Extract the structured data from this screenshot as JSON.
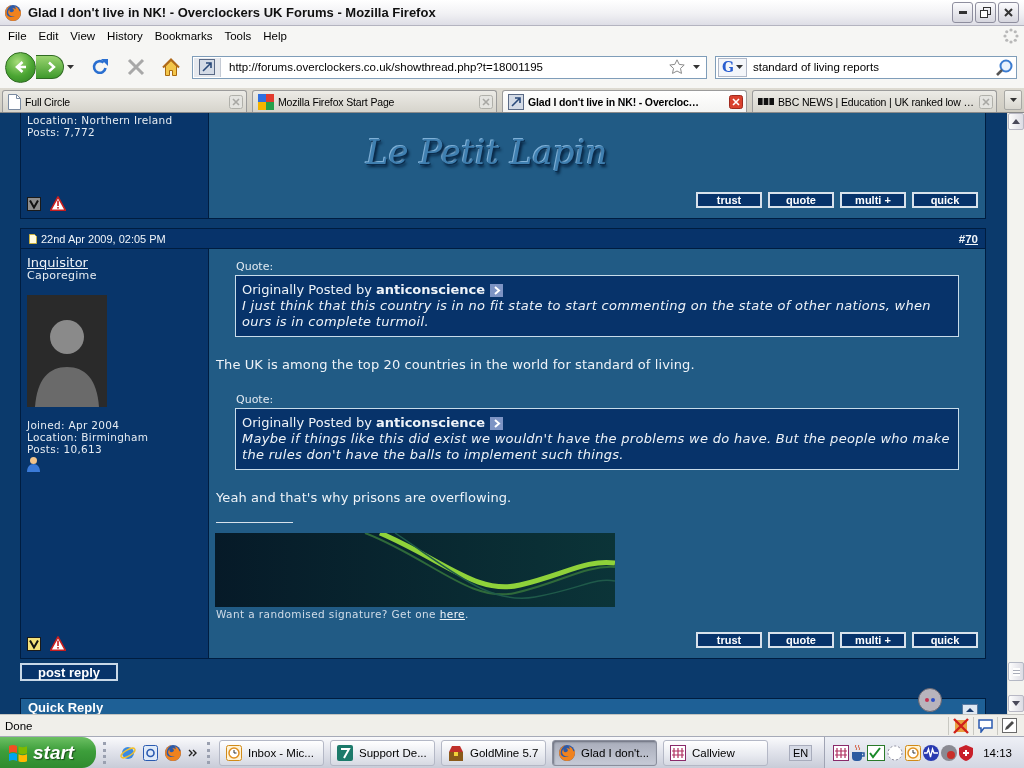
{
  "window": {
    "title": "Glad I don't live in NK! - Overclockers UK Forums - Mozilla Firefox"
  },
  "menu": [
    {
      "label": "File"
    },
    {
      "label": "Edit"
    },
    {
      "label": "View"
    },
    {
      "label": "History"
    },
    {
      "label": "Bookmarks"
    },
    {
      "label": "Tools"
    },
    {
      "label": "Help"
    }
  ],
  "navigation": {
    "address": "http://forums.overclockers.co.uk/showthread.php?t=18001195",
    "search_engine": "G",
    "search": "standard of living reports"
  },
  "tabs": [
    {
      "label": "Full Circle",
      "selected": false
    },
    {
      "label": "Mozilla Firefox Start Page",
      "selected": false
    },
    {
      "label": "Glad I don't live in NK! - Overcloc…",
      "selected": true
    },
    {
      "label": "BBC NEWS | Education | UK ranked low …",
      "selected": false
    }
  ],
  "posts": [
    {
      "author": {
        "details": [
          "Location: Northern Ireland",
          "Posts: 7,772"
        ]
      },
      "badge": {
        "color": "#8e8e8e"
      },
      "signature": {
        "kind": "logo",
        "title": "Le Petit Lapin"
      },
      "buttons": [
        "trust",
        "quote",
        "multi +",
        "quick"
      ]
    },
    {
      "header": {
        "date": "22nd Apr 2009, 02:05 PM",
        "hash": "#",
        "number": "70"
      },
      "author": {
        "name": "Inquisitor",
        "rank": "Caporegime",
        "avatar": true,
        "details": [
          "Joined: Apr 2004",
          "Location: Birmingham",
          "Posts: 10,613"
        ],
        "online": true
      },
      "body": [
        {
          "kind": "quote",
          "label": "Quote:",
          "byline": "Originally Posted by **anticonscience**",
          "text": "I just think that this country is in no fit state to start commenting on the state of other nations, when ours is in complete turmoil."
        },
        {
          "kind": "text",
          "text": "The UK is among the top 20 countries in the world for standard of living."
        },
        {
          "kind": "quote",
          "label": "Quote:",
          "byline": "Originally Posted by **anticonscience**",
          "text": "Maybe if things like this did exist we wouldn't have the problems we do have. But the people who make the rules don't have the balls to implement such things."
        },
        {
          "kind": "text",
          "text": "Yeah and that's why prisons are overflowing."
        }
      ],
      "badge": {
        "color": "#f2e07a"
      },
      "signature": {
        "kind": "banner",
        "note": "Want a randomised signature? Get one",
        "link": "here",
        "end": "."
      },
      "buttons": [
        "trust",
        "quote",
        "multi +",
        "quick"
      ]
    }
  ],
  "post_reply": {
    "label": "post reply"
  },
  "quick_reply": {
    "title": "Quick Reply"
  },
  "status_bar": {
    "text": "Done"
  },
  "taskbar": {
    "start": "start",
    "tasks": [
      {
        "label": "Inbox - Mic...",
        "selected": false
      },
      {
        "label": "Support De...",
        "selected": false
      },
      {
        "label": "GoldMine 5.7",
        "selected": false
      },
      {
        "label": "Glad I don't...",
        "selected": true
      },
      {
        "label": "Callview",
        "selected": false
      }
    ],
    "language": "EN",
    "clock": "14:13"
  }
}
